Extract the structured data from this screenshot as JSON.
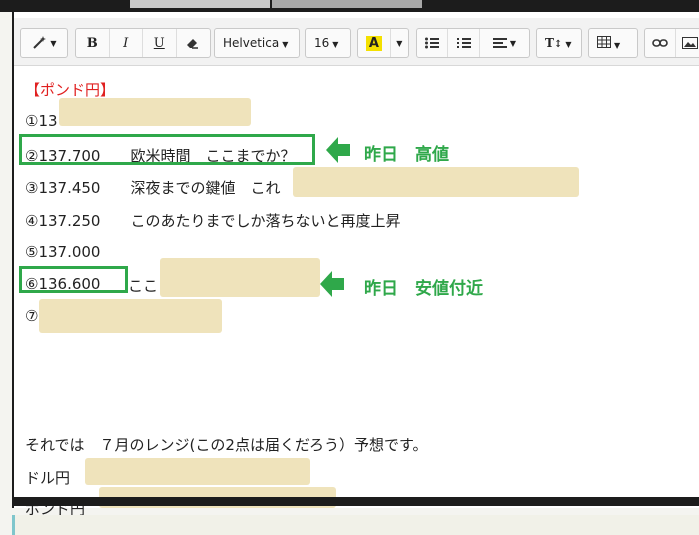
{
  "toolbar": {
    "font_family": "Helvetica",
    "font_size": "16",
    "color_label": "A",
    "bold": "B",
    "italic": "I",
    "underline": "U",
    "text_style": "T"
  },
  "content": {
    "heading": "【ポンド円】",
    "lines": [
      "①13",
      "②137.700　　欧米時間　ここまでか？",
      "③137.450　　深夜までの鍵値　これ",
      "④137.250　　このあたりまでしか落ちないと再度上昇",
      "⑤137.000",
      "⑥136.600",
      "ここ",
      "⑦"
    ],
    "annotations": [
      "昨日　高値",
      "昨日　安値付近"
    ],
    "closing": "それでは　７月のレンジ(この2点は届くだろう）予想です。",
    "dollar_yen": "ドル円",
    "pound_yen": "ポンド円"
  },
  "colors": {
    "accent_green": "#2fa84a",
    "heading_red": "#e02020",
    "redaction": "#efe3bb"
  }
}
